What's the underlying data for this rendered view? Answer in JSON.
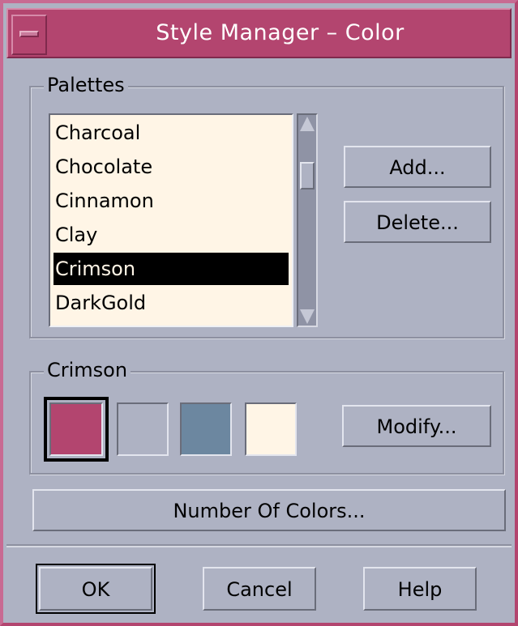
{
  "window": {
    "title": "Style Manager – Color"
  },
  "palettes": {
    "label": "Palettes",
    "items": [
      "Charcoal",
      "Chocolate",
      "Cinnamon",
      "Clay",
      "Crimson",
      "DarkGold"
    ],
    "selected": "Crimson",
    "add_label": "Add...",
    "delete_label": "Delete..."
  },
  "current_palette": {
    "label": "Crimson",
    "colors": [
      "#b3456f",
      "#aeb2c3",
      "#6c87a0",
      "#fff5e6"
    ],
    "selected_index": 0,
    "modify_label": "Modify..."
  },
  "number_of_colors_label": "Number Of Colors...",
  "dialog_buttons": {
    "ok": "OK",
    "cancel": "Cancel",
    "help": "Help"
  }
}
